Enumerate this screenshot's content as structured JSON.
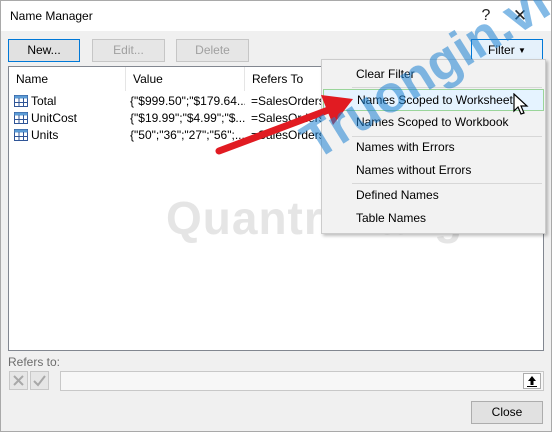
{
  "window": {
    "title": "Name Manager",
    "help_glyph": "?",
    "close_glyph": "✕"
  },
  "toolbar": {
    "new_label": "New...",
    "edit_label": "Edit...",
    "delete_label": "Delete",
    "filter_label": "Filter"
  },
  "list": {
    "headers": {
      "name": "Name",
      "value": "Value",
      "refers_to": "Refers To"
    },
    "rows": [
      {
        "name": "Total",
        "value": "{\"$999.50\";\"$179.64...",
        "refers_to": "=SalesOrders!"
      },
      {
        "name": "UnitCost",
        "value": "{\"$19.99\";\"$4.99\";\"$...",
        "refers_to": "=SalesOrders!"
      },
      {
        "name": "Units",
        "value": "{\"50\";\"36\";\"27\";\"56\";...",
        "refers_to": "=SalesOrders!"
      }
    ]
  },
  "filter_menu": {
    "items": [
      {
        "label": "Clear Filter"
      },
      {
        "label": "Names Scoped to Worksheet",
        "highlighted": true
      },
      {
        "label": "Names Scoped to Workbook"
      },
      {
        "label": "Names with Errors"
      },
      {
        "label": "Names without Errors"
      },
      {
        "label": "Defined Names"
      },
      {
        "label": "Table Names"
      }
    ]
  },
  "refers_to": {
    "label": "Refers to:",
    "value": ""
  },
  "footer": {
    "close_label": "Close"
  },
  "watermark": {
    "text": "Quantrimang",
    "brand": "Truongin.vn"
  },
  "colors": {
    "accent": "#0078d7",
    "arrow": "#e11b22",
    "highlight": "#e5f3ff"
  }
}
